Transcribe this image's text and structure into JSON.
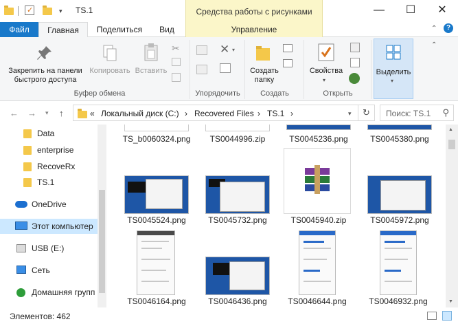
{
  "titlebar": {
    "title": "TS.1",
    "context_tab_header": "Средства работы с рисунками",
    "minimize_glyph": "—",
    "maximize_glyph": "☐",
    "close_glyph": "✕"
  },
  "tabs": {
    "file": "Файл",
    "home": "Главная",
    "share": "Поделиться",
    "view": "Вид",
    "manage": "Управление"
  },
  "ribbon": {
    "pin_label_1": "Закрепить на панели",
    "pin_label_2": "быстрого доступа",
    "copy_label": "Копировать",
    "paste_label": "Вставить",
    "clipboard_group": "Буфер обмена",
    "organize_group": "Упорядочить",
    "new_folder_label_1": "Создать",
    "new_folder_label_2": "папку",
    "new_group": "Создать",
    "properties_label": "Свойства",
    "open_group": "Открыть",
    "select_label": "Выделить"
  },
  "address": {
    "prefix": "«",
    "parts": [
      "Локальный диск (C:)",
      "Recovered Files",
      "TS.1"
    ],
    "separator": "›",
    "search_placeholder": "Поиск: TS.1"
  },
  "nav_pane": {
    "items": [
      {
        "label": "Data"
      },
      {
        "label": "enterprise"
      },
      {
        "label": "RecoveRx"
      },
      {
        "label": "TS.1"
      },
      {
        "label": "OneDrive"
      },
      {
        "label": "Этот компьютер"
      },
      {
        "label": "USB (E:)"
      },
      {
        "label": "Сеть"
      },
      {
        "label": "Домашняя групп"
      }
    ]
  },
  "files": [
    {
      "name": "TS_b0060324.png"
    },
    {
      "name": "TS0044996.zip"
    },
    {
      "name": "TS0045236.png"
    },
    {
      "name": "TS0045380.png"
    },
    {
      "name": "TS0045524.png"
    },
    {
      "name": "TS0045732.png"
    },
    {
      "name": "TS0045940.zip"
    },
    {
      "name": "TS0045972.png"
    },
    {
      "name": "TS0046164.png"
    },
    {
      "name": "TS0046436.png"
    },
    {
      "name": "TS0046644.png"
    },
    {
      "name": "TS0046932.png"
    }
  ],
  "status": {
    "items_count": "Элементов: 462"
  },
  "colors": {
    "file_tab": "#1979ca",
    "context_tab": "#fbf6c9",
    "selection": "#cce8ff",
    "folder": "#f4c84a"
  }
}
